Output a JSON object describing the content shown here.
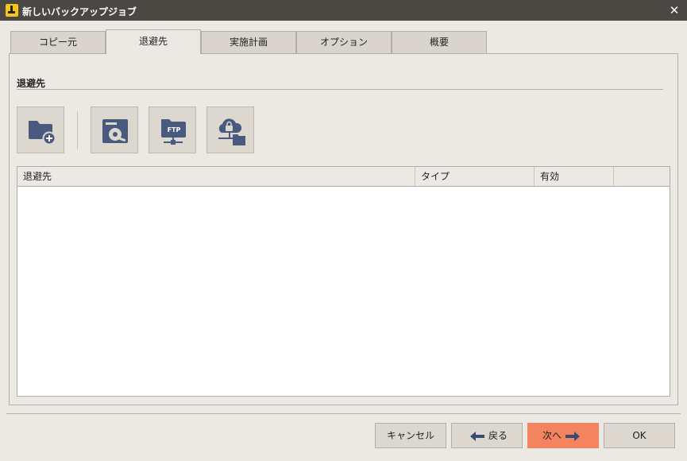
{
  "window": {
    "title": "新しいバックアップジョブ",
    "close_glyph": "✕"
  },
  "tabs": [
    {
      "label": "コピー元",
      "active": false
    },
    {
      "label": "退避先",
      "active": true
    },
    {
      "label": "実施計画",
      "active": false
    },
    {
      "label": "オプション",
      "active": false
    },
    {
      "label": "概要",
      "active": false
    }
  ],
  "section": {
    "title": "退避先"
  },
  "toolbar": {
    "icons": [
      "add-folder-icon",
      "local-drive-icon",
      "ftp-icon",
      "secure-cloud-icon"
    ],
    "ftp_text": "FTP"
  },
  "table": {
    "columns": [
      "退避先",
      "タイプ",
      "有効",
      ""
    ],
    "rows": []
  },
  "footer": {
    "cancel": "キャンセル",
    "back": "戻る",
    "next": "次へ",
    "ok": "OK"
  },
  "colors": {
    "accent": "#f4845f",
    "titlebar": "#4b4843",
    "icon": "#4a5a7e"
  }
}
